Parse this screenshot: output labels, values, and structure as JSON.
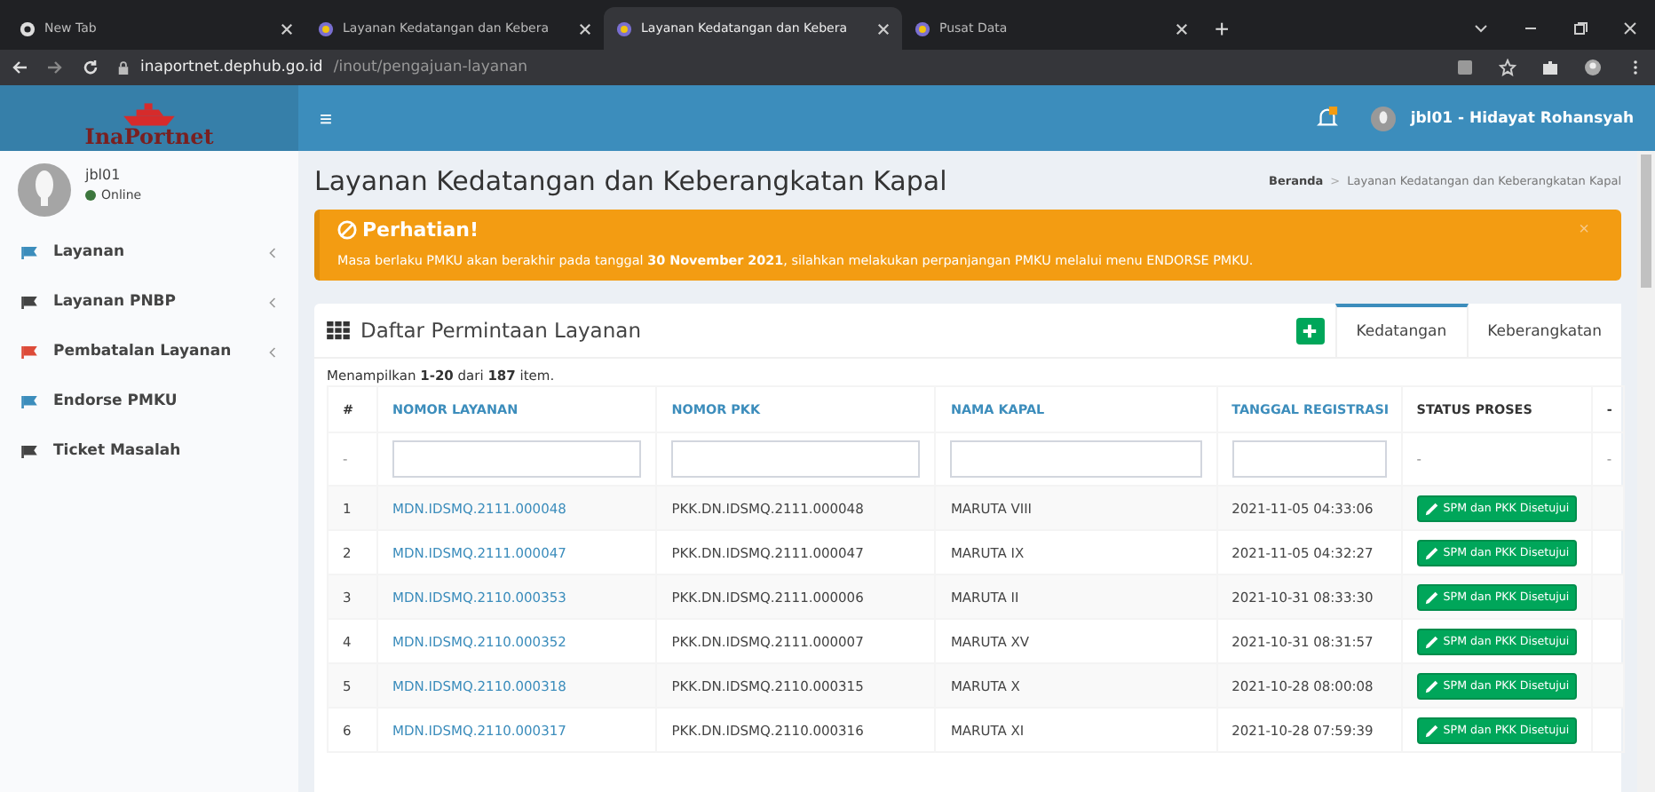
{
  "browser": {
    "tabs": [
      {
        "title": "New Tab",
        "selected": false
      },
      {
        "title": "Layanan Kedatangan dan Kebera",
        "selected": false
      },
      {
        "title": "Layanan Kedatangan dan Kebera",
        "selected": true
      },
      {
        "title": "Pusat Data",
        "selected": false
      }
    ],
    "new_tab": "+",
    "url_host": "inaportnet.dephub.go.id",
    "url_path": "/inout/pengajuan-layanan"
  },
  "header": {
    "logo": "InaPortnet",
    "menu_toggle": "≡",
    "notification": true,
    "user": "jbl01 - Hidayat Rohansyah"
  },
  "sidebar": {
    "user": {
      "name": "jbl01",
      "status": "Online"
    },
    "items": [
      {
        "label": "Layanan",
        "color": "#3c8dbc",
        "submenu": true
      },
      {
        "label": "Layanan PNBP",
        "color": "#444444",
        "submenu": true
      },
      {
        "label": "Pembatalan Layanan",
        "color": "#dd4b39",
        "submenu": true
      },
      {
        "label": "Endorse PMKU",
        "color": "#3c8dbc",
        "submenu": false
      },
      {
        "label": "Ticket Masalah",
        "color": "#444444",
        "submenu": false
      }
    ]
  },
  "page": {
    "title": "Layanan Kedatangan dan Keberangkatan Kapal",
    "breadcrumb_separator": ">",
    "breadcrumb": [
      "Beranda",
      "Layanan Kedatangan dan Keberangkatan Kapal"
    ]
  },
  "alert": {
    "title": "Perhatian!",
    "message": "Masa berlaku PMKU akan berakhir pada tanggal **30 November 2021**, silahkan melakukan perpanjangan PMKU melalui menu ENDORSE PMKU.",
    "close": "×"
  },
  "panel": {
    "title": "Daftar Permintaan Layanan",
    "tabs": [
      {
        "label": "Kedatangan",
        "selected": true
      },
      {
        "label": "Keberangkatan",
        "selected": false
      }
    ],
    "summary": "Menampilkan **1-20** dari **187** item.",
    "table": {
      "columns": [
        {
          "label": "#",
          "sortable": false
        },
        {
          "label": "NOMOR LAYANAN",
          "sortable": true
        },
        {
          "label": "NOMOR PKK",
          "sortable": true
        },
        {
          "label": "NAMA KAPAL",
          "sortable": true
        },
        {
          "label": "TANGGAL REGISTRASI",
          "sortable": true
        },
        {
          "label": "STATUS PROSES",
          "sortable": false
        },
        {
          "label": "-",
          "sortable": false
        }
      ],
      "filters": [
        {
          "kind": "text",
          "value": "-"
        },
        {
          "kind": "input"
        },
        {
          "kind": "input"
        },
        {
          "kind": "input"
        },
        {
          "kind": "input"
        },
        {
          "kind": "text",
          "value": "-"
        },
        {
          "kind": "text",
          "value": "-"
        }
      ],
      "rows": [
        {
          "no": "1",
          "nomor_layanan": "MDN.IDSMQ.2111.000048",
          "nomor_pkk": "PKK.DN.IDSMQ.2111.000048",
          "nama_kapal": "MARUTA VIII",
          "tanggal": "2021-11-05 04:33:06",
          "status": "SPM dan PKK Disetujui"
        },
        {
          "no": "2",
          "nomor_layanan": "MDN.IDSMQ.2111.000047",
          "nomor_pkk": "PKK.DN.IDSMQ.2111.000047",
          "nama_kapal": "MARUTA IX",
          "tanggal": "2021-11-05 04:32:27",
          "status": "SPM dan PKK Disetujui"
        },
        {
          "no": "3",
          "nomor_layanan": "MDN.IDSMQ.2110.000353",
          "nomor_pkk": "PKK.DN.IDSMQ.2111.000006",
          "nama_kapal": "MARUTA II",
          "tanggal": "2021-10-31 08:33:30",
          "status": "SPM dan PKK Disetujui"
        },
        {
          "no": "4",
          "nomor_layanan": "MDN.IDSMQ.2110.000352",
          "nomor_pkk": "PKK.DN.IDSMQ.2111.000007",
          "nama_kapal": "MARUTA XV",
          "tanggal": "2021-10-31 08:31:57",
          "status": "SPM dan PKK Disetujui"
        },
        {
          "no": "5",
          "nomor_layanan": "MDN.IDSMQ.2110.000318",
          "nomor_pkk": "PKK.DN.IDSMQ.2110.000315",
          "nama_kapal": "MARUTA X",
          "tanggal": "2021-10-28 08:00:08",
          "status": "SPM dan PKK Disetujui"
        },
        {
          "no": "6",
          "nomor_layanan": "MDN.IDSMQ.2110.000317",
          "nomor_pkk": "PKK.DN.IDSMQ.2110.000316",
          "nama_kapal": "MARUTA XI",
          "tanggal": "2021-10-28 07:59:39",
          "status": "SPM dan PKK Disetujui"
        }
      ]
    }
  }
}
